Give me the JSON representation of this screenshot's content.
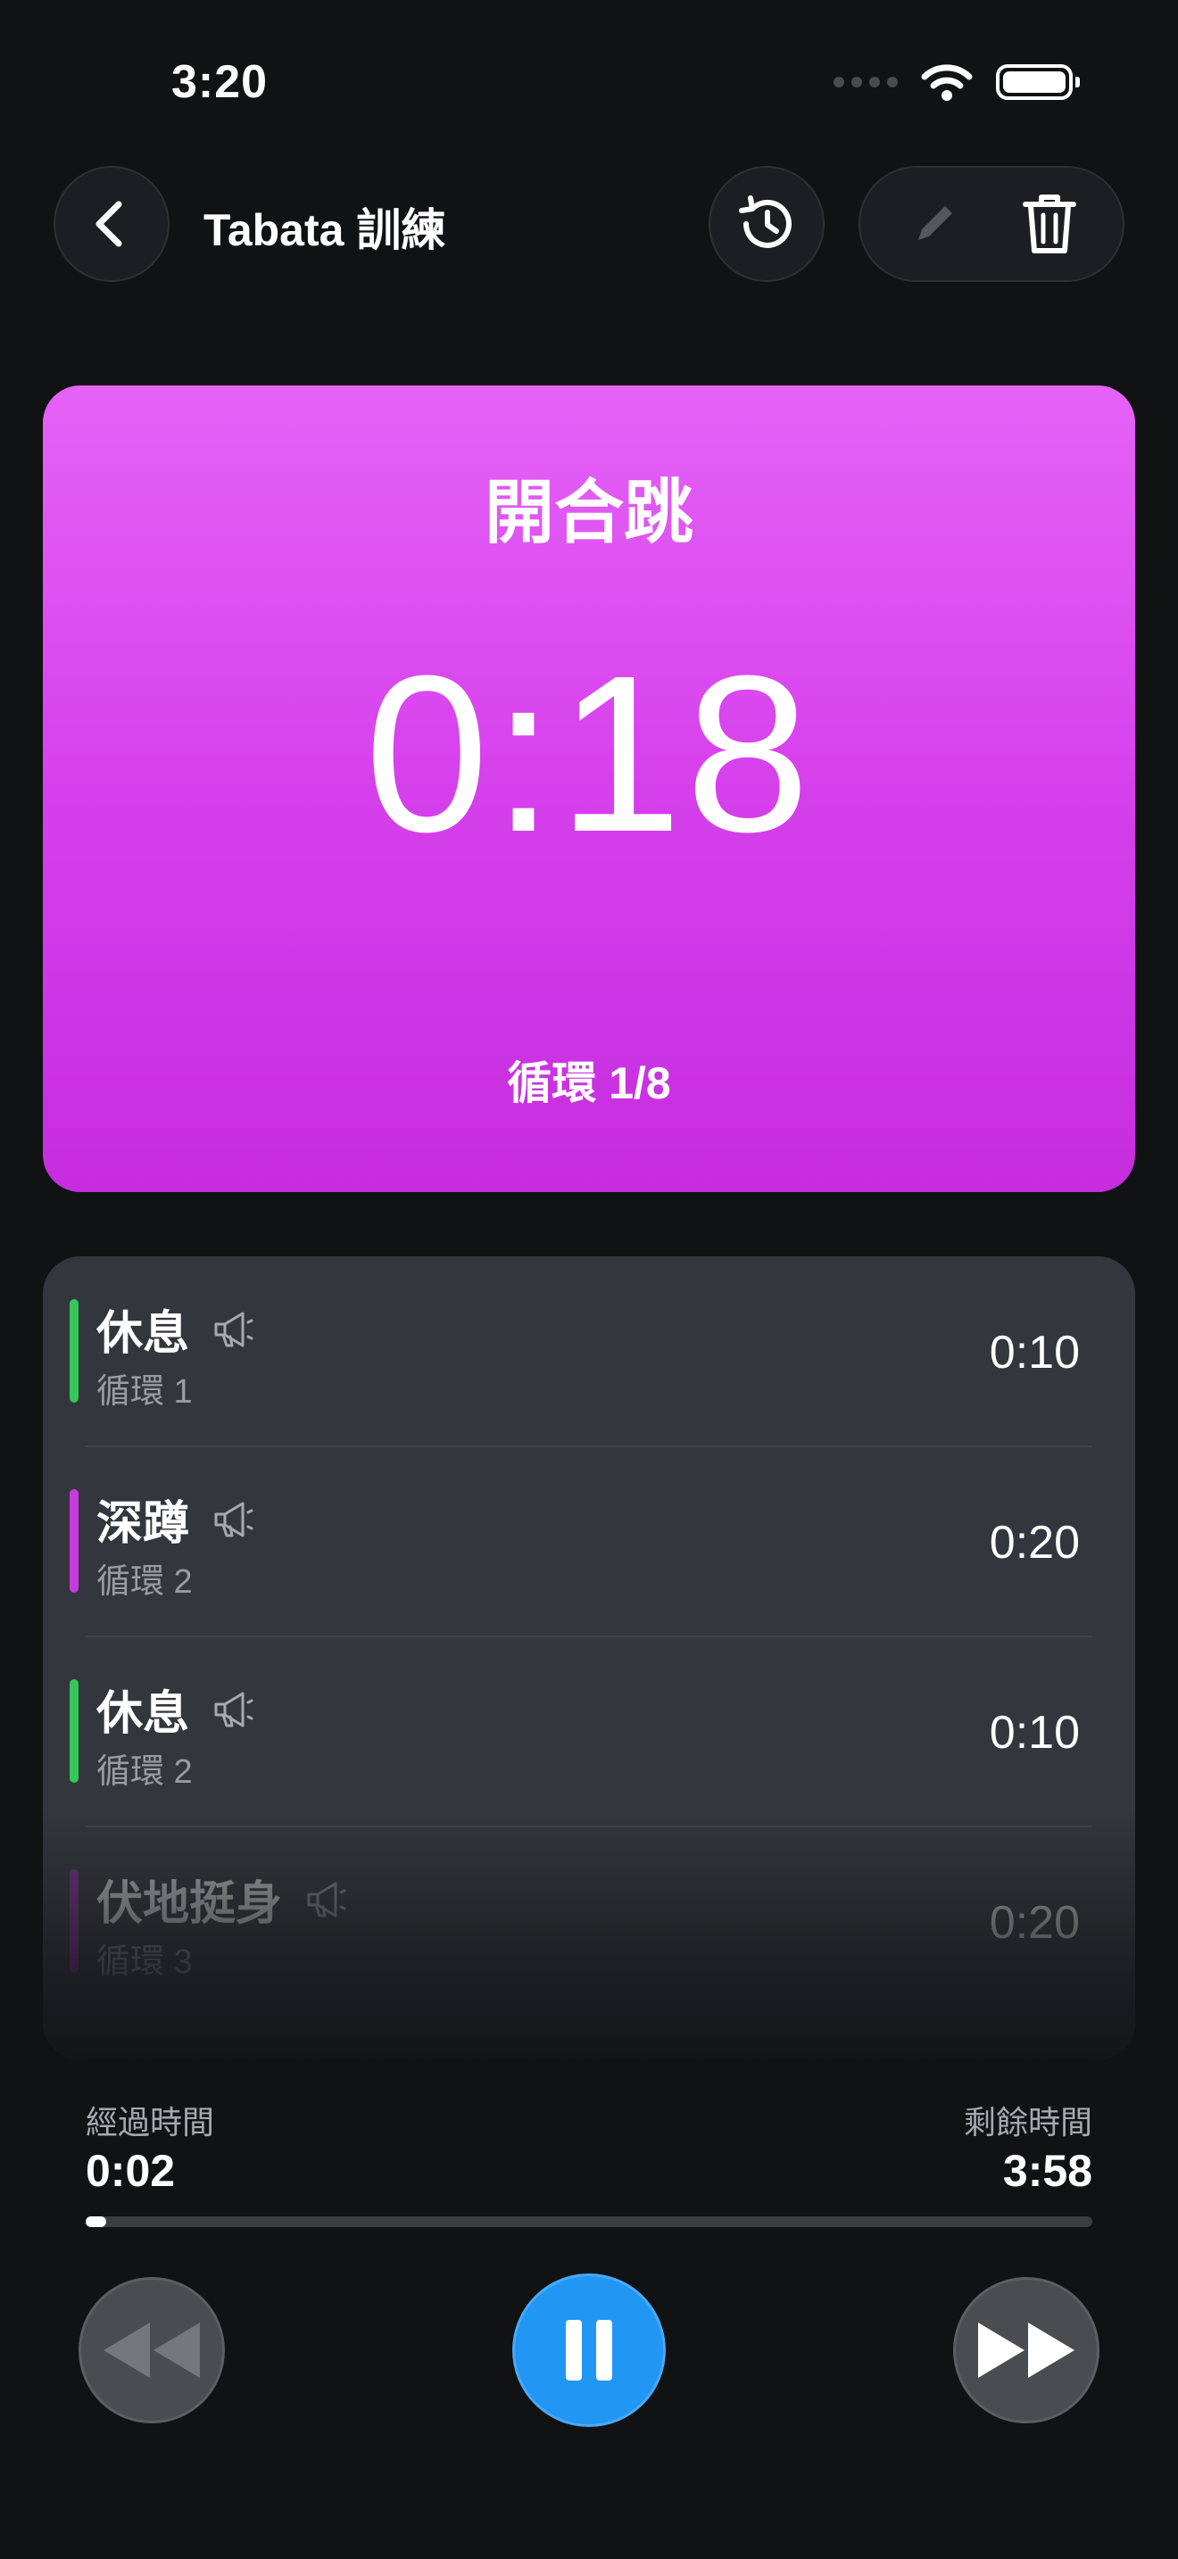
{
  "status_bar": {
    "time": "3:20"
  },
  "nav": {
    "title": "Tabata 訓練"
  },
  "hero": {
    "exercise": "開合跳",
    "countdown": "0:18",
    "round": "循環 1/8",
    "color": "#d640ec"
  },
  "queue": [
    {
      "name": "休息",
      "round": "循環 1",
      "time": "0:10",
      "color": "#34c759"
    },
    {
      "name": "深蹲",
      "round": "循環 2",
      "time": "0:20",
      "color": "#c93ae0"
    },
    {
      "name": "休息",
      "round": "循環 2",
      "time": "0:10",
      "color": "#34c759"
    },
    {
      "name": "伏地挺身",
      "round": "循環 3",
      "time": "0:20",
      "color": "#9b2fb0"
    }
  ],
  "footer": {
    "elapsed_label": "經過時間",
    "elapsed": "0:02",
    "remaining_label": "剩餘時間",
    "remaining": "3:58",
    "progress_fraction": 0.02
  },
  "icons": {
    "back": "chevron-left-icon",
    "history": "history-icon",
    "edit": "pencil-icon",
    "delete": "trash-icon",
    "announce": "megaphone-icon",
    "rewind": "rewind-icon",
    "pause": "pause-icon",
    "fast_forward": "fast-forward-icon"
  },
  "colors": {
    "background": "#111214",
    "accent": "#2196f3",
    "rest": "#34c759",
    "work": "#d640ec"
  }
}
